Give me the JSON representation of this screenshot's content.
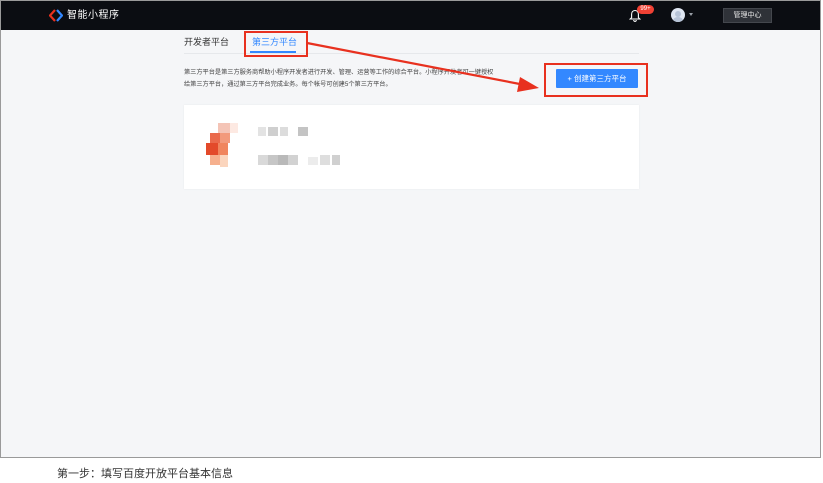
{
  "header": {
    "app_title": "智能小程序",
    "notification_badge": "99+",
    "admin_button": "管理中心"
  },
  "tabs": [
    {
      "label": "开发者平台",
      "active": false
    },
    {
      "label": "第三方平台",
      "active": true
    }
  ],
  "main": {
    "description_line1": "第三方平台是第三方服务商帮助小程序开发者进行开发、管理、运营等工作的综合平台。小程序开发者可一键授权",
    "description_line2": "给第三方平台，通过第三方平台完成业务。每个帐号可创建5个第三方平台。",
    "create_button": "+ 创建第三方平台"
  },
  "caption": "第一步：填写百度开放平台基本信息",
  "colors": {
    "accent": "#3388ff",
    "highlight": "#e8311f",
    "topbar": "#0b0d12"
  }
}
